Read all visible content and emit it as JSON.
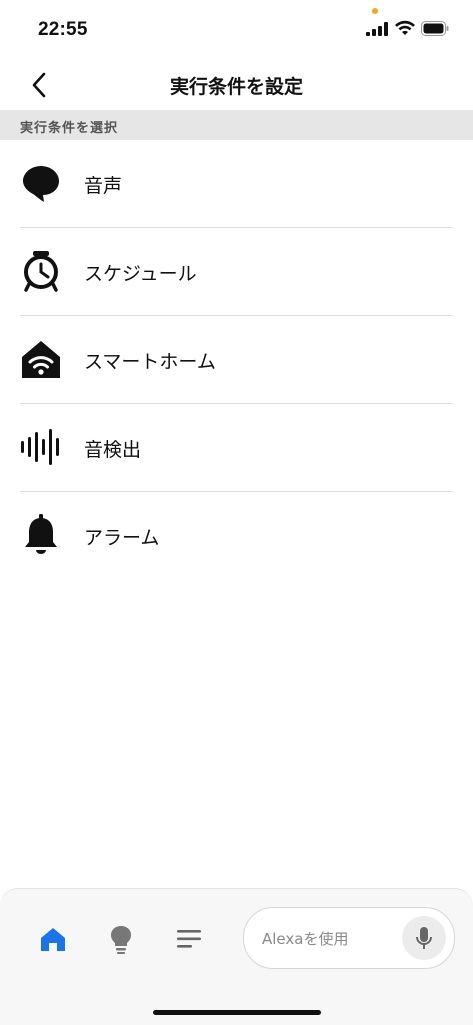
{
  "status": {
    "time": "22:55"
  },
  "nav": {
    "title": "実行条件を設定",
    "back_icon": "chevron-left-icon"
  },
  "section": {
    "header": "実行条件を選択"
  },
  "triggers": [
    {
      "label": "音声",
      "icon": "speech-bubble-icon"
    },
    {
      "label": "スケジュール",
      "icon": "alarm-clock-icon"
    },
    {
      "label": "スマートホーム",
      "icon": "smart-home-icon"
    },
    {
      "label": "音検出",
      "icon": "sound-wave-icon"
    },
    {
      "label": "アラーム",
      "icon": "bell-icon"
    }
  ],
  "bottom_nav": {
    "tabs": [
      {
        "icon": "home-icon",
        "active": true
      },
      {
        "icon": "lightbulb-icon",
        "active": false
      },
      {
        "icon": "menu-lines-icon",
        "active": false
      }
    ],
    "alexa_placeholder": "Alexaを使用",
    "mic_icon": "microphone-icon"
  },
  "colors": {
    "accent": "#1a73e8",
    "icon_dark": "#111111",
    "section_bg": "#e6e6e6"
  }
}
